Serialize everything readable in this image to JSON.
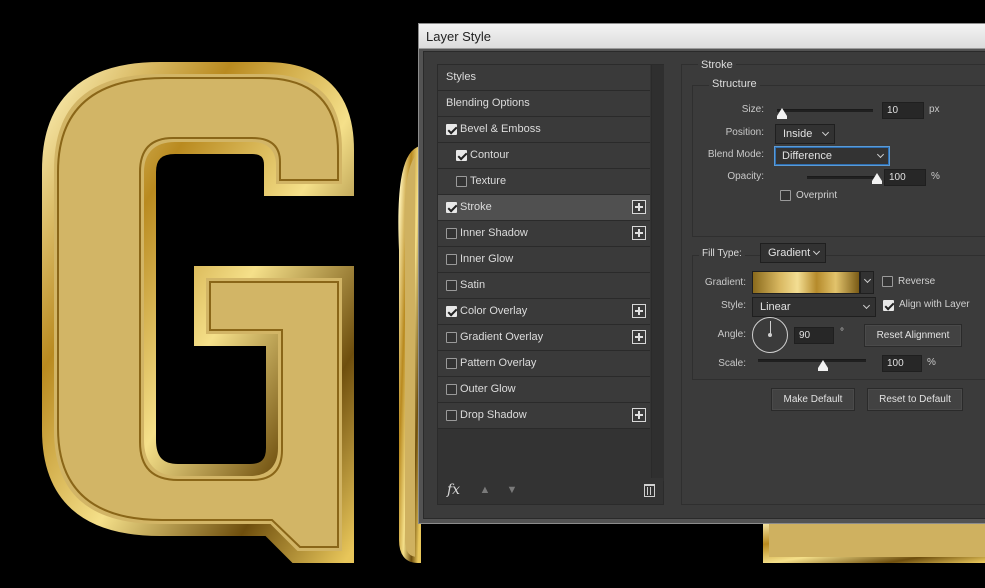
{
  "window": {
    "title": "Layer Style"
  },
  "styles_list": {
    "items": [
      {
        "label": "Styles",
        "checkbox": false,
        "checked": false,
        "plus": false,
        "indent": false,
        "active": false
      },
      {
        "label": "Blending Options",
        "checkbox": false,
        "checked": false,
        "plus": false,
        "indent": false,
        "active": false
      },
      {
        "label": "Bevel & Emboss",
        "checkbox": true,
        "checked": true,
        "plus": false,
        "indent": false,
        "active": false
      },
      {
        "label": "Contour",
        "checkbox": true,
        "checked": true,
        "plus": false,
        "indent": true,
        "active": false
      },
      {
        "label": "Texture",
        "checkbox": true,
        "checked": false,
        "plus": false,
        "indent": true,
        "active": false
      },
      {
        "label": "Stroke",
        "checkbox": true,
        "checked": true,
        "plus": true,
        "indent": false,
        "active": true
      },
      {
        "label": "Inner Shadow",
        "checkbox": true,
        "checked": false,
        "plus": true,
        "indent": false,
        "active": false
      },
      {
        "label": "Inner Glow",
        "checkbox": true,
        "checked": false,
        "plus": false,
        "indent": false,
        "active": false
      },
      {
        "label": "Satin",
        "checkbox": true,
        "checked": false,
        "plus": false,
        "indent": false,
        "active": false
      },
      {
        "label": "Color Overlay",
        "checkbox": true,
        "checked": true,
        "plus": true,
        "indent": false,
        "active": false
      },
      {
        "label": "Gradient Overlay",
        "checkbox": true,
        "checked": false,
        "plus": true,
        "indent": false,
        "active": false
      },
      {
        "label": "Pattern Overlay",
        "checkbox": true,
        "checked": false,
        "plus": false,
        "indent": false,
        "active": false
      },
      {
        "label": "Outer Glow",
        "checkbox": true,
        "checked": false,
        "plus": false,
        "indent": false,
        "active": false
      },
      {
        "label": "Drop Shadow",
        "checkbox": true,
        "checked": false,
        "plus": true,
        "indent": false,
        "active": false
      }
    ],
    "footer": {
      "fx_label": "fx"
    }
  },
  "stroke": {
    "section_title": "Stroke",
    "structure_title": "Structure",
    "size": {
      "label": "Size:",
      "value": "10",
      "unit": "px",
      "level": 0.05
    },
    "position": {
      "label": "Position:",
      "value": "Inside"
    },
    "blend_mode": {
      "label": "Blend Mode:",
      "value": "Difference"
    },
    "opacity": {
      "label": "Opacity:",
      "value": "100",
      "unit": "%",
      "level": 1.0
    },
    "overprint": {
      "label": "Overprint",
      "checked": false
    },
    "fill_type": {
      "label": "Fill Type:",
      "value": "Gradient"
    },
    "gradient": {
      "label": "Gradient:"
    },
    "reverse": {
      "label": "Reverse",
      "checked": false
    },
    "style": {
      "label": "Style:",
      "value": "Linear"
    },
    "align_with_layer": {
      "label": "Align with Layer",
      "checked": true
    },
    "angle": {
      "label": "Angle:",
      "value": "90",
      "unit": "°"
    },
    "reset_alignment": {
      "label": "Reset Alignment"
    },
    "scale": {
      "label": "Scale:",
      "value": "100",
      "unit": "%",
      "level": 0.6
    },
    "make_default": {
      "label": "Make Default"
    },
    "reset_to_default": {
      "label": "Reset to Default"
    }
  },
  "canvas": {
    "letters_color": "#d4b765",
    "icons": [
      "gold-letter-g",
      "gold-letter-o"
    ]
  }
}
